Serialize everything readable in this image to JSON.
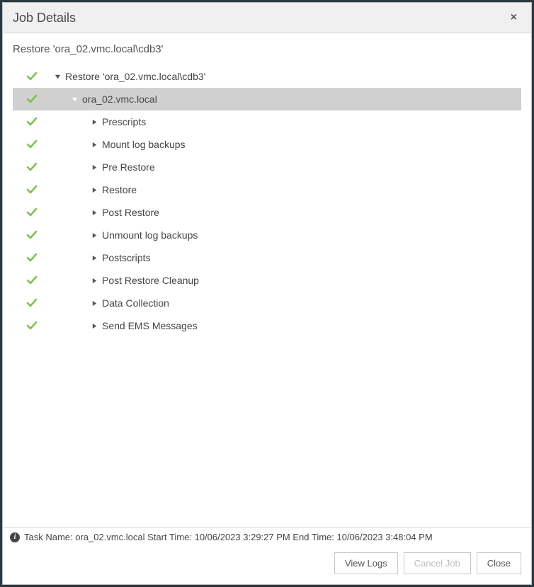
{
  "dialog": {
    "title": "Job Details",
    "close_glyph": "×"
  },
  "subtitle": "Restore 'ora_02.vmc.local\\cdb3'",
  "tree": [
    {
      "level": 0,
      "expanded": true,
      "selected": false,
      "label": "Restore 'ora_02.vmc.local\\cdb3'",
      "status": "success"
    },
    {
      "level": 1,
      "expanded": true,
      "selected": true,
      "label": "ora_02.vmc.local",
      "status": "success"
    },
    {
      "level": 2,
      "expanded": false,
      "selected": false,
      "label": "Prescripts",
      "status": "success"
    },
    {
      "level": 2,
      "expanded": false,
      "selected": false,
      "label": "Mount log backups",
      "status": "success"
    },
    {
      "level": 2,
      "expanded": false,
      "selected": false,
      "label": "Pre Restore",
      "status": "success"
    },
    {
      "level": 2,
      "expanded": false,
      "selected": false,
      "label": "Restore",
      "status": "success"
    },
    {
      "level": 2,
      "expanded": false,
      "selected": false,
      "label": "Post Restore",
      "status": "success"
    },
    {
      "level": 2,
      "expanded": false,
      "selected": false,
      "label": "Unmount log backups",
      "status": "success"
    },
    {
      "level": 2,
      "expanded": false,
      "selected": false,
      "label": "Postscripts",
      "status": "success"
    },
    {
      "level": 2,
      "expanded": false,
      "selected": false,
      "label": "Post Restore Cleanup",
      "status": "success"
    },
    {
      "level": 2,
      "expanded": false,
      "selected": false,
      "label": "Data Collection",
      "status": "success"
    },
    {
      "level": 2,
      "expanded": false,
      "selected": false,
      "label": "Send EMS Messages",
      "status": "success"
    }
  ],
  "status_bar": {
    "text": "Task Name: ora_02.vmc.local Start Time: 10/06/2023 3:29:27 PM End Time: 10/06/2023 3:48:04 PM"
  },
  "buttons": {
    "view_logs": "View Logs",
    "cancel_job": "Cancel Job",
    "close": "Close"
  },
  "colors": {
    "success_check": "#7cc04b",
    "caret_dark": "#555555",
    "caret_light": "#ffffff"
  }
}
